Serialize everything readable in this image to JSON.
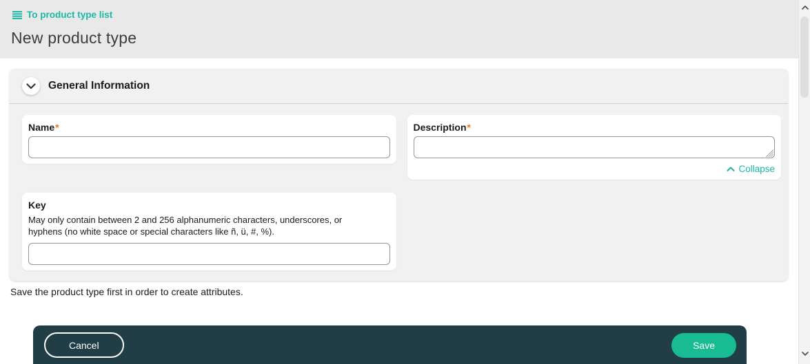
{
  "page": {
    "title": "New product type"
  },
  "breadcrumb": {
    "label": "To product type list",
    "icon": "list-icon"
  },
  "panel": {
    "title": "General Information",
    "collapse_label": "Collapse"
  },
  "fields": {
    "name": {
      "label": "Name",
      "required": "*",
      "value": "",
      "placeholder": ""
    },
    "description": {
      "label": "Description",
      "required": "*",
      "value": "",
      "placeholder": ""
    },
    "key": {
      "label": "Key",
      "hint": "May only contain between 2 and 256 alphanumeric characters, underscores, or hyphens (no white space or special characters like ñ, ü, #, %).",
      "value": "",
      "placeholder": ""
    }
  },
  "note": "Save the product type first in order to create attributes.",
  "actions": {
    "cancel": "Cancel",
    "save": "Save"
  },
  "colors": {
    "accent": "#1cb8a3",
    "save": "#18bb92",
    "bar": "#213e46",
    "required": "#ee7326",
    "topband": "#e9e9e9",
    "panel_bg": "#f1f1f1"
  }
}
